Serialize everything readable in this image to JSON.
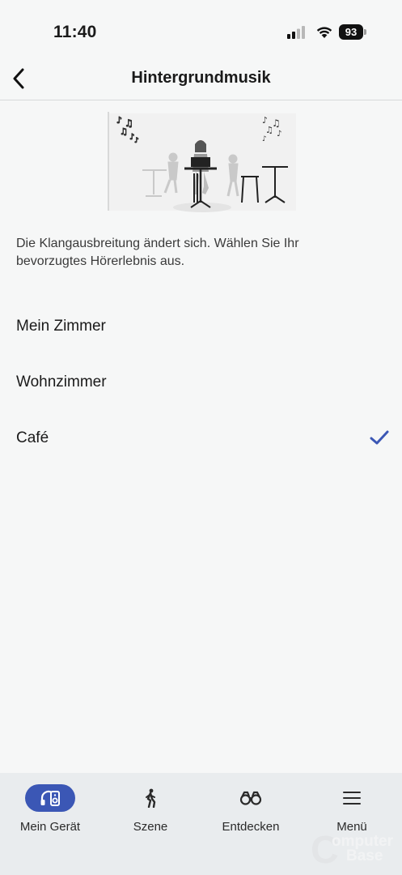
{
  "status_bar": {
    "time": "11:40",
    "battery": "93",
    "icons": [
      "cellular-signal-icon",
      "wifi-icon",
      "battery-icon"
    ]
  },
  "header": {
    "title": "Hintergrundmusik",
    "back_icon": "chevron-left-icon"
  },
  "illustration": {
    "icon": "cafe-scene-illustration"
  },
  "description": "Die Klangausbreitung ändert sich. Wählen Sie Ihr bevorzugtes Hörerlebnis aus.",
  "options": [
    {
      "label": "Mein Zimmer",
      "selected": false
    },
    {
      "label": "Wohnzimmer",
      "selected": false
    },
    {
      "label": "Café",
      "selected": true
    }
  ],
  "tabs": [
    {
      "label": "Mein Gerät",
      "icon": "headphones-speaker-icon",
      "active": true
    },
    {
      "label": "Szene",
      "icon": "walking-person-icon",
      "active": false
    },
    {
      "label": "Entdecken",
      "icon": "binoculars-icon",
      "active": false
    },
    {
      "label": "Menü",
      "icon": "hamburger-menu-icon",
      "active": false
    }
  ],
  "colors": {
    "accent": "#3b57b5",
    "background": "#f6f7f7",
    "tab_bar": "#e9ecee",
    "divider": "#d7d9da"
  },
  "watermark": {
    "big": "C",
    "line1": "omputer",
    "line2": "Base"
  }
}
